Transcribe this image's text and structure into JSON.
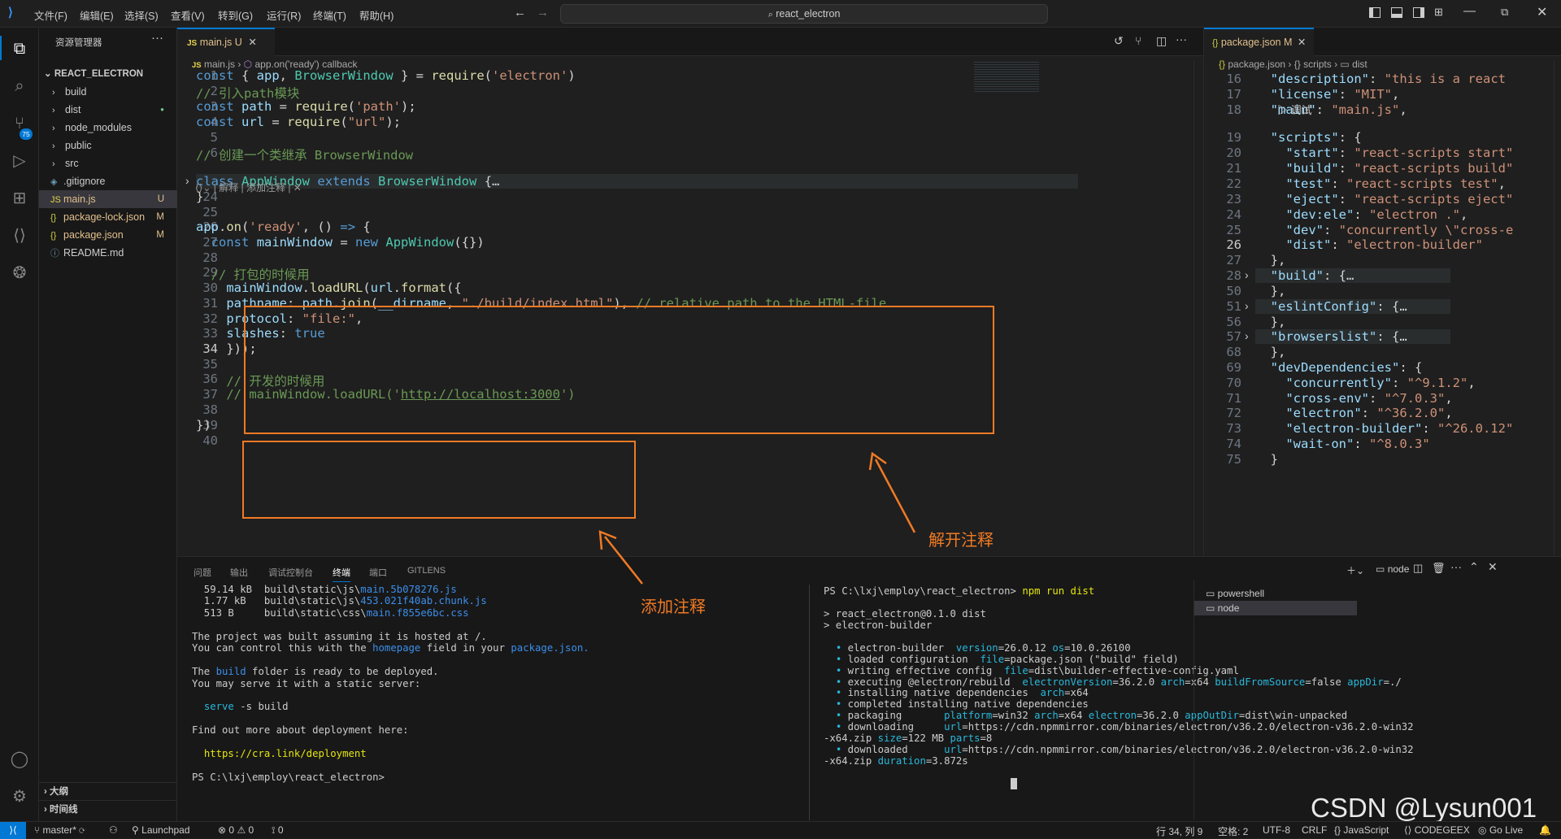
{
  "menu": [
    "文件(F)",
    "编辑(E)",
    "选择(S)",
    "查看(V)",
    "转到(G)",
    "运行(R)",
    "终端(T)",
    "帮助(H)"
  ],
  "search": "react_electron",
  "explorer": {
    "title": "资源管理器",
    "root": "REACT_ELECTRON",
    "items": [
      {
        "label": "build",
        "badge": ""
      },
      {
        "label": "dist",
        "badge": "●"
      },
      {
        "label": "node_modules",
        "badge": ""
      },
      {
        "label": "public",
        "badge": ""
      },
      {
        "label": "src",
        "badge": ""
      },
      {
        "label": ".gitignore",
        "badge": ""
      },
      {
        "label": "main.js",
        "badge": "U"
      },
      {
        "label": "package-lock.json",
        "badge": "M"
      },
      {
        "label": "package.json",
        "badge": "M"
      },
      {
        "label": "README.md",
        "badge": ""
      }
    ],
    "outline": "大纲",
    "timeline": "时间线"
  },
  "editor": {
    "tab": "main.js",
    "tab_badge": "U",
    "breadcrumb_file": "main.js",
    "breadcrumb_symbol": "app.on('ready') callback",
    "codelens": "解释 | 添加注释 | ✕"
  },
  "code_lines": [
    {
      "n": "1",
      "html": "<span class='tok-k'>const</span> { <span class='tok-v'>app</span>, <span class='tok-t'>BrowserWindow</span> } = <span class='tok-f'>require</span>(<span class='tok-s'>'electron'</span>)"
    },
    {
      "n": "2",
      "html": "<span class='tok-c'>// 引入path模块</span>"
    },
    {
      "n": "3",
      "html": "<span class='tok-k'>const</span> <span class='tok-v'>path</span> = <span class='tok-f'>require</span>(<span class='tok-s'>'path'</span>);"
    },
    {
      "n": "4",
      "html": "<span class='tok-k'>const</span> <span class='tok-v'>url</span> = <span class='tok-f'>require</span>(<span class='tok-s'>\"url\"</span>);"
    },
    {
      "n": "5",
      "html": ""
    },
    {
      "n": "6",
      "html": "<span class='tok-c'>// 创建一个类继承 BrowserWindow</span>"
    },
    {
      "n": "7",
      "html": "<span class='tok-k'>class</span> <span class='tok-t'>AppWindow</span> <span class='tok-k'>extends</span> <span class='tok-t'>BrowserWindow</span> {…"
    },
    {
      "n": "24",
      "html": "}"
    },
    {
      "n": "25",
      "html": ""
    },
    {
      "n": "26",
      "html": "<span class='tok-v'>app</span>.<span class='tok-f'>on</span>(<span class='tok-s'>'ready'</span>, () <span class='tok-k'>=&gt;</span> {"
    },
    {
      "n": "27",
      "html": "  <span class='tok-k'>const</span> <span class='tok-v'>mainWindow</span> = <span class='tok-k'>new</span> <span class='tok-t'>AppWindow</span>({})"
    },
    {
      "n": "28",
      "html": ""
    },
    {
      "n": "29",
      "html": "  <span class='tok-c'>// 打包的时候用</span>"
    },
    {
      "n": "30",
      "html": "    <span class='tok-v'>mainWindow</span>.<span class='tok-f'>loadURL</span>(<span class='tok-v'>url</span>.<span class='tok-f'>format</span>({"
    },
    {
      "n": "31",
      "html": "    <span class='tok-v'>pathname</span>: <span class='tok-v'>path</span>.<span class='tok-f'>join</span>(<span class='tok-v'>__dirname</span>, <span class='tok-s'>\"./build/index.html\"</span>), <span class='tok-c'>// relative path to the HTML-file</span>"
    },
    {
      "n": "32",
      "html": "    <span class='tok-v'>protocol</span>: <span class='tok-s'>\"file:\"</span>,"
    },
    {
      "n": "33",
      "html": "    <span class='tok-v'>slashes</span>: <span class='tok-k'>true</span>"
    },
    {
      "n": "34",
      "html": "    }));"
    },
    {
      "n": "35",
      "html": ""
    },
    {
      "n": "36",
      "html": "    <span class='tok-c'>// 开发的时候用</span>"
    },
    {
      "n": "37",
      "html": "    <span class='tok-c'>// mainWindow.loadURL('<u>http://localhost:3000</u>')</span>"
    },
    {
      "n": "38",
      "html": ""
    },
    {
      "n": "39",
      "html": "})"
    },
    {
      "n": "40",
      "html": ""
    }
  ],
  "json_editor": {
    "tab": "package.json",
    "tab_badge": "M",
    "breadcrumb": "package.json › {} scripts › ▭ dist",
    "debug_label": "▷ 调试"
  },
  "json_lines": [
    {
      "n": "16",
      "html": "  <span class='tok-v'>\"description\"</span>: <span class='tok-s'>\"this is a react</span>"
    },
    {
      "n": "17",
      "html": "  <span class='tok-v'>\"license\"</span>: <span class='tok-s'>\"MIT\"</span>,"
    },
    {
      "n": "18",
      "html": "  <span class='tok-v'>\"main\"</span>: <span class='tok-s'>\"main.js\"</span>,"
    },
    {
      "n": "19",
      "html": "  <span class='tok-v'>\"scripts\"</span>: {"
    },
    {
      "n": "20",
      "html": "    <span class='tok-v'>\"start\"</span>: <span class='tok-s'>\"react-scripts start\"</span>"
    },
    {
      "n": "21",
      "html": "    <span class='tok-v'>\"build\"</span>: <span class='tok-s'>\"react-scripts build\"</span>"
    },
    {
      "n": "22",
      "html": "    <span class='tok-v'>\"test\"</span>: <span class='tok-s'>\"react-scripts test\"</span>,"
    },
    {
      "n": "23",
      "html": "    <span class='tok-v'>\"eject\"</span>: <span class='tok-s'>\"react-scripts eject\"</span>"
    },
    {
      "n": "24",
      "html": "    <span class='tok-v'>\"dev:ele\"</span>: <span class='tok-s'>\"electron .\"</span>,"
    },
    {
      "n": "25",
      "html": "    <span class='tok-v'>\"dev\"</span>: <span class='tok-s'>\"concurrently \\\"cross-e</span>"
    },
    {
      "n": "26",
      "html": "    <span class='tok-v'>\"dist\"</span>: <span class='tok-s'>\"electron-builder\"</span>"
    },
    {
      "n": "27",
      "html": "  },"
    },
    {
      "n": "28",
      "html": "  <span class='tok-v'>\"build\"</span>: {…"
    },
    {
      "n": "50",
      "html": "  },"
    },
    {
      "n": "51",
      "html": "  <span class='tok-v'>\"eslintConfig\"</span>: {…"
    },
    {
      "n": "56",
      "html": "  },"
    },
    {
      "n": "57",
      "html": "  <span class='tok-v'>\"browserslist\"</span>: {…"
    },
    {
      "n": "68",
      "html": "  },"
    },
    {
      "n": "69",
      "html": "  <span class='tok-v'>\"devDependencies\"</span>: {"
    },
    {
      "n": "70",
      "html": "    <span class='tok-v'>\"concurrently\"</span>: <span class='tok-s'>\"^9.1.2\"</span>,"
    },
    {
      "n": "71",
      "html": "    <span class='tok-v'>\"cross-env\"</span>: <span class='tok-s'>\"^7.0.3\"</span>,"
    },
    {
      "n": "72",
      "html": "    <span class='tok-v'>\"electron\"</span>: <span class='tok-s'>\"^36.2.0\"</span>,"
    },
    {
      "n": "73",
      "html": "    <span class='tok-v'>\"electron-builder\"</span>: <span class='tok-s'>\"^26.0.12\"</span>"
    },
    {
      "n": "74",
      "html": "    <span class='tok-v'>\"wait-on\"</span>: <span class='tok-s'>\"^8.0.3\"</span>"
    },
    {
      "n": "75",
      "html": "  }"
    }
  ],
  "panel_tabs": [
    "问题",
    "输出",
    "调试控制台",
    "终端",
    "端口",
    "GITLENS"
  ],
  "terminal_left": [
    "  59.14 kB  build\\static\\js\\main.5b078276.js",
    "  1.77 kB   build\\static\\js\\453.021f40ab.chunk.js",
    "  513 B     build\\static\\css\\main.f855e6bc.css",
    "",
    "The project was built assuming it is hosted at /.",
    "You can control this with the homepage field in your package.json.",
    "",
    "The build folder is ready to be deployed.",
    "You may serve it with a static server:",
    "",
    "  serve -s build",
    "",
    "Find out more about deployment here:",
    "",
    "  https://cra.link/deployment",
    "",
    "PS C:\\lxj\\employ\\react_electron> "
  ],
  "terminal_right": [
    "PS C:\\lxj\\employ\\react_electron> npm run dist",
    "",
    "> react_electron@0.1.0 dist",
    "> electron-builder",
    "",
    "  • electron-builder  version=26.0.12 os=10.0.26100",
    "  • loaded configuration  file=package.json (\"build\" field)",
    "  • writing effective config  file=dist\\builder-effective-config.yaml",
    "  • executing @electron/rebuild  electronVersion=36.2.0 arch=x64 buildFromSource=false appDir=./",
    "  • installing native dependencies  arch=x64",
    "  • completed installing native dependencies",
    "  • packaging       platform=win32 arch=x64 electron=36.2.0 appOutDir=dist\\win-unpacked",
    "  • downloading     url=https://cdn.npmmirror.com/binaries/electron/v36.2.0/electron-v36.2.0-win32",
    "-x64.zip size=122 MB parts=8",
    "  • downloaded      url=https://cdn.npmmirror.com/binaries/electron/v36.2.0/electron-v36.2.0-win32",
    "-x64.zip duration=3.872s"
  ],
  "terminal_sessions": [
    "powershell",
    "node"
  ],
  "terminal_toolbar": {
    "shell": "node"
  },
  "annotations": {
    "uncomment": "解开注释",
    "add_comment": "添加注释"
  },
  "watermark": "CSDN @Lysun001",
  "status": {
    "branch": "master*",
    "launchpad": "Launchpad",
    "errors": "0",
    "warnings": "0",
    "ports": "0",
    "position": "行 34, 列 9",
    "spaces": "空格: 2",
    "encoding": "UTF-8",
    "eol": "CRLF",
    "language": "JavaScript",
    "codegeex": "CODEGEEX",
    "golive": "Go Live",
    "badge75": "75"
  }
}
